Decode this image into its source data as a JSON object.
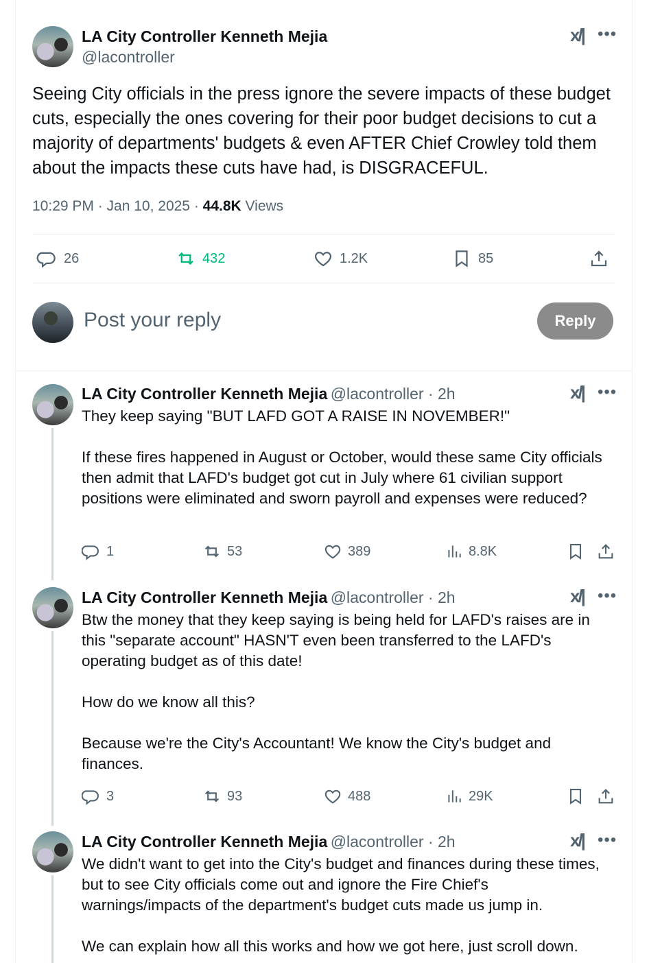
{
  "main_post": {
    "author_name": "LA City Controller Kenneth Mejia",
    "author_handle": "@lacontroller",
    "text": "Seeing City officials in the press ignore the severe impacts of these budget cuts, especially the ones covering for their poor budget decisions to cut a majority of departments' budgets & even AFTER Chief Crowley told them about the impacts these cuts have had, is DISGRACEFUL.",
    "timestamp": "10:29 PM · Jan 10, 2025 · ",
    "views_count": "44.8K",
    "views_label": " Views",
    "stats": {
      "replies": "26",
      "reposts": "432",
      "likes": "1.2K",
      "bookmarks": "85"
    }
  },
  "reply_box": {
    "placeholder": "Post your reply",
    "button_label": "Reply"
  },
  "thread": [
    {
      "author_name": "LA City Controller Kenneth Mejia",
      "handle_time": "@lacontroller · 2h",
      "text": "They keep saying \"BUT LAFD GOT A RAISE IN NOVEMBER!\"\n\nIf these fires happened in August or October, would these same City officials then admit that LAFD's budget got cut in July where 61 civilian support positions were eliminated and sworn payroll and expenses were reduced?",
      "replies": "1",
      "reposts": "53",
      "likes": "389",
      "views": "8.8K"
    },
    {
      "author_name": "LA City Controller Kenneth Mejia",
      "handle_time": "@lacontroller · 2h",
      "text": "Btw the money that they keep saying is being held for LAFD's raises are in this \"separate account\" HASN'T even been transferred to the LAFD's operating budget as of this date!\n\nHow do we know all this?\n\nBecause we're the City's Accountant! We know the City's budget and finances.",
      "replies": "3",
      "reposts": "93",
      "likes": "488",
      "views": "29K"
    },
    {
      "author_name": "LA City Controller Kenneth Mejia",
      "handle_time": "@lacontroller · 2h",
      "text": "We didn't want to get into the City's budget and finances during these times, but to see City officials come out and ignore the Fire Chief's warnings/impacts of the department's budget cuts made us jump in.\n\nWe can explain how all this works and how we got here, just scroll down."
    }
  ],
  "icons": {
    "grok": "x-ai-icon",
    "more": "more-icon",
    "reply": "reply-icon",
    "repost": "repost-icon",
    "like": "like-icon",
    "bookmark": "bookmark-icon",
    "share": "share-icon",
    "views": "views-icon"
  },
  "colors": {
    "repost_active": "#00ba7c",
    "secondary_text": "#536471",
    "reply_button": "#8b8b8b"
  }
}
